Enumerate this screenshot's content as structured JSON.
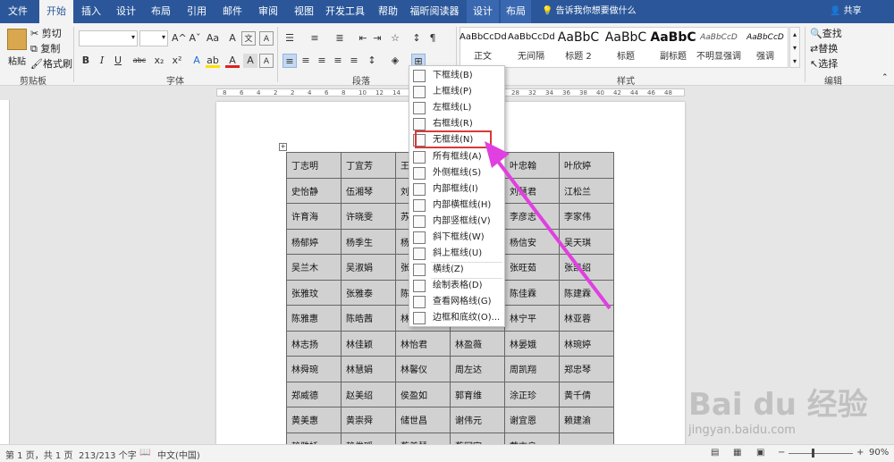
{
  "tabs": [
    "文件",
    "开始",
    "插入",
    "设计",
    "布局",
    "引用",
    "邮件",
    "审阅",
    "视图",
    "开发工具",
    "帮助",
    "福昕阅读器",
    "设计",
    "布局"
  ],
  "tellme": "告诉我你想要做什么",
  "share": "共享",
  "clipboard": {
    "paste": "粘贴",
    "cut": "剪切",
    "copy": "复制",
    "format_painter": "格式刷",
    "label": "剪贴板"
  },
  "font": {
    "label": "字体",
    "bold": "B",
    "italic": "I",
    "underline": "U",
    "strike": "abc",
    "sub": "x₂",
    "sup": "x²",
    "grow": "A^",
    "shrink": "Aˇ",
    "aa": "Aa",
    "clear": "A",
    "color_a": "A",
    "highlight": "ab",
    "char_a": "A"
  },
  "paragraph": {
    "label": "段落"
  },
  "styles": {
    "label": "样式",
    "items": [
      {
        "preview": "AaBbCcDd",
        "name": "正文"
      },
      {
        "preview": "AaBbCcDd",
        "name": "无间隔"
      },
      {
        "preview": "AaBbC",
        "name": "标题 2"
      },
      {
        "preview": "AaBbC",
        "name": "标题"
      },
      {
        "preview": "AaBbC",
        "name": "副标题"
      },
      {
        "preview": "AaBbCcD",
        "name": "不明显强调"
      },
      {
        "preview": "AaBbCcD",
        "name": "强调"
      }
    ]
  },
  "editing": {
    "label": "编辑",
    "find": "查找",
    "replace": "替换",
    "select": "选择"
  },
  "ruler_ticks": [
    "8",
    "6",
    "4",
    "2",
    "2",
    "4",
    "6",
    "8",
    "10",
    "12",
    "14",
    "16",
    "18",
    "20",
    "22",
    "24",
    "26",
    "28",
    "32",
    "34",
    "36",
    "38",
    "40",
    "42",
    "44",
    "46",
    "48"
  ],
  "table_rows": [
    [
      "丁志明",
      "丁宜芳",
      "王",
      "",
      "叶忠翰",
      "叶欣婷"
    ],
    [
      "史怡静",
      "伍湘琴",
      "刘",
      "",
      "刘慧君",
      "江松兰"
    ],
    [
      "许育海",
      "许晓雯",
      "苏",
      "",
      "李彦志",
      "李家伟"
    ],
    [
      "杨郁婷",
      "杨季生",
      "杨",
      "",
      "杨信安",
      "吴天琪"
    ],
    [
      "吴兰木",
      "吴淑娟",
      "张",
      "",
      "张旺茹",
      "张凯绍"
    ],
    [
      "张雅玟",
      "张雅泰",
      "陈",
      "",
      "陈佳霖",
      "陈建霖"
    ],
    [
      "陈雅惠",
      "陈皓茜",
      "林",
      "",
      "林宁平",
      "林亚蓉"
    ],
    [
      "林志扬",
      "林佳颖",
      "林怡君",
      "林盈薇",
      "林晏娥",
      "林琬婷"
    ],
    [
      "林舜琬",
      "林慧娟",
      "林馨仪",
      "周左达",
      "周凯翔",
      "郑忠琴"
    ],
    [
      "郑威德",
      "赵美绍",
      "侯盈如",
      "郭育维",
      "涂正珍",
      "黄千倩"
    ],
    [
      "黄美惠",
      "黄崇舜",
      "储世昌",
      "谢伟元",
      "谢宜恩",
      "赖建渝"
    ],
    [
      "赖雅娇",
      "赖俊瑶",
      "蔡美慧",
      "蔡冠宇",
      "戴志良",
      ""
    ]
  ],
  "menu_items": [
    {
      "label": "下框线(B)"
    },
    {
      "label": "上框线(P)"
    },
    {
      "label": "左框线(L)"
    },
    {
      "label": "右框线(R)"
    },
    {
      "label": "无框线(N)"
    },
    {
      "label": "所有框线(A)"
    },
    {
      "label": "外侧框线(S)"
    },
    {
      "label": "内部框线(I)"
    },
    {
      "label": "内部横框线(H)"
    },
    {
      "label": "内部竖框线(V)"
    },
    {
      "label": "斜下框线(W)"
    },
    {
      "label": "斜上框线(U)"
    },
    {
      "label": "横线(Z)"
    },
    {
      "label": "绘制表格(D)"
    },
    {
      "label": "查看网格线(G)"
    },
    {
      "label": "边框和底纹(O)..."
    }
  ],
  "highlight_color": "#d9383a",
  "arrow_color": "#e040e0",
  "status": {
    "page": "第 1 页，共 1 页",
    "words": "213/213 个字",
    "lang": "中文(中国)",
    "zoom": "90%"
  },
  "watermark": {
    "brand": "Bai du 经验",
    "url": "jingyan.baidu.com"
  }
}
